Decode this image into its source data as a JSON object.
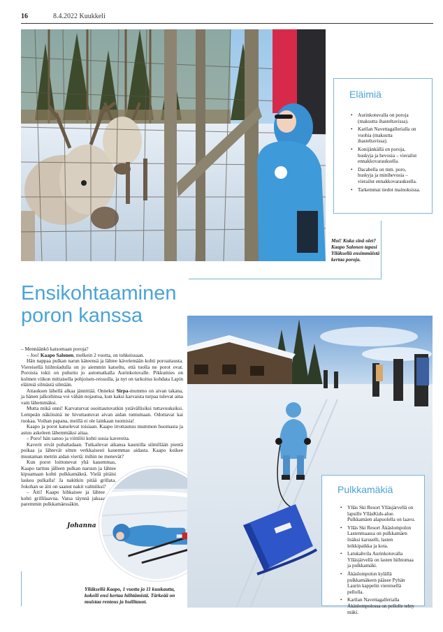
{
  "header": {
    "page_number": "16",
    "date_publication": "8.4.2022 Kuukkeli"
  },
  "sidebar_top": {
    "title": "Eläimiä",
    "items": [
      "Aurinkotuvalla on poroja (maksutta ihasteltavissa).",
      "Karilan Navettagallerialla on vuohia (maksutta ihasteltavissa).",
      "Konijänkällä on poroja, huskyja ja hevosia – vierailut ennakkovarauksella.",
      "Dacabella on mm. poro, huskyja ja minihevosia – vierailut ennakkovarauksella.",
      "Tarkemmat tiedot mainoksissa."
    ]
  },
  "caption_top": "Moi! Kuka sinä olet? Kaapo Salonen tapasi Ylläksellä ensimmäistä kertaa poroja.",
  "headline": {
    "line1": "Ensikohtaaminen",
    "line2": "poron kanssa"
  },
  "article": {
    "p1": "– Mennäänkö katsomaan poroja?",
    "p2_prefix": "– Joo! ",
    "p2_name": "Kaapo Salonen",
    "p2_rest": ", melkein 2 vuotta, on tohkeissaan.",
    "p3": "Hän nappaa pulkan narun käteensä ja lähtee kävelemään kohti poroaitausta. Viereisellä hiihtoladulla on jo aiemmin katseltu, että tuolla ne porot ovat. Poroista tokii on puhuttu jo automatkalla Aurinkotuvalle. Pikkumies on kolmen viikon mittaisella pohjoisen-reissulla, ja nyt on tarkoitus kohdata Lapin eläimiä silmästä silmään.",
    "p4_prefix": "Aitauksen lähellä alkaa jännittää. Onneksi ",
    "p4_name": "Sirpa",
    "p4_rest": "-mummo on aivan takana, ja hänen jalkoihinsa voi vähän nojautua, kun kaksi karvaista turpaa tulevat aina vain lähemmäksi.",
    "p5": "Mutta mikä onni! Karvaturvat osoittautuvatkin ystävällisiksi tuttavuuksiksi. Lempeän näköisinä ne hivuttautuvat aivan aidan tuntumaan. Odottavat kai ruokaa. Voihan papana, meillä ei ole lainkaan tuomisia!",
    "p6": "Kaapo ja porot katselevat toisiaan. Kaapo irrottautuu mummon huomasta ja astuu askeleen lähemmäksi aitaa.",
    "p7": "– Poro! hän sanoo ja viittilöi kohti uusia kavereita.",
    "p8": "Kaverit eivät puhaltadaan. Tutkailevat aikansa kauniilla silmillään pientä poikaa ja lähtevät sitten verkkaisesti kauemmas aidasta. Kaapo kuikee muutaman metrin aidan viertä: mihin ne menevät?",
    "p9": "Kun porot loittonevat yhä kauemmas, Kaapo tarttuu jälleen pulkan naruun ja lähtee kipuamaan kohti pulkkamäkeä. Vielä pitäisi laskea pulkalla! Ja nakitkin pitää grillata. Jokohan se äiti on saanut nakit valmiiksi?",
    "p10": "– Äiti! Kaapo hihkaisee ja lähtee kohti grillilaavua. Vatsa täynnä jaksaa paremmin pulkkamäessäkin."
  },
  "signature": "Johanna",
  "caption_bottom": "Ylläksellä Kaapo, 1 vuotta ja 11 kuukautta, kokeili ensi kertaa hiihtämistä. Tärkeää on muistaa rentous ja huilitauot.",
  "sidebar_bottom": {
    "title": "Pulkkamäkiä",
    "items": [
      "Ylläs Ski Resort Ylläsjärvellä on lapsille YlläsKids-alue. Pulkkamäen alapuolella on laavu.",
      "Ylläs Ski Resort Äkäslompolon Lastenmaassa on pulkkamäen lisäksi karuselli, lasten leikkipaikka ja kota.",
      "Latukahvila Aurinkotuvalla Ylläsjärvellä on lasten hiihtomaa ja pulkkamäki.",
      "Äkäslompolon kylällä pulkkamäkeen pääsee Pyhän Laurin kappelin viereisellä pellolla.",
      "Karilan Navettagallerialla Äkäslompolossa on pellolle tehty mäki."
    ]
  },
  "colors": {
    "accent": "#4aa3d6",
    "box_border": "#7fb3d8"
  }
}
